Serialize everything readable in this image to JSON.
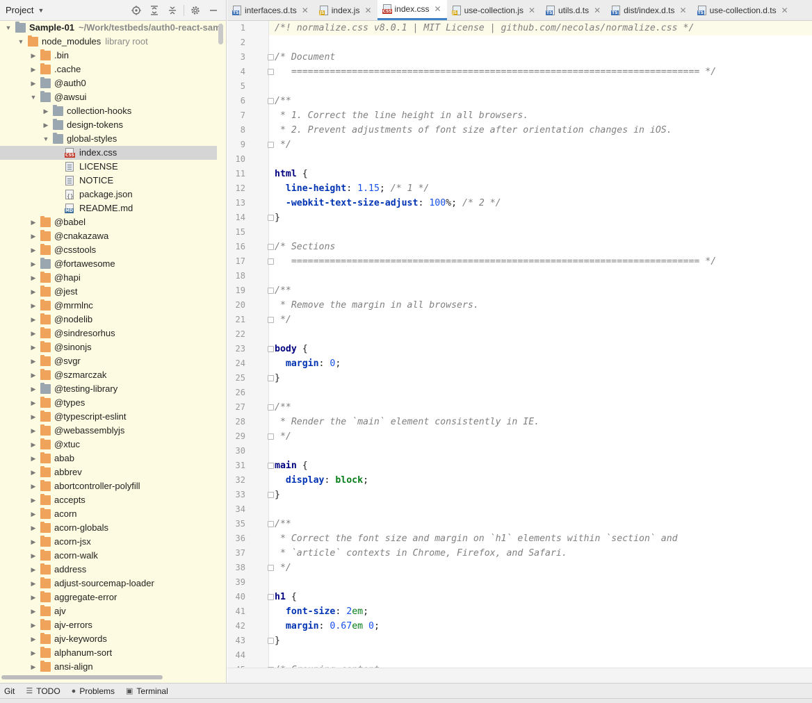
{
  "project_panel": {
    "title": "Project",
    "icons": [
      "locate-icon",
      "expand-all-icon",
      "collapse-all-icon",
      "gear-icon",
      "minimize-icon"
    ]
  },
  "tree": [
    {
      "label": "Sample-01",
      "extra": "~/Work/testbeds/auth0-react-sam",
      "depth": 0,
      "type": "module",
      "expanded": true,
      "bold": true
    },
    {
      "label": "node_modules",
      "extra": "library root",
      "depth": 1,
      "type": "folder-orange",
      "expanded": true
    },
    {
      "label": ".bin",
      "depth": 2,
      "type": "folder-orange",
      "expanded": false
    },
    {
      "label": ".cache",
      "depth": 2,
      "type": "folder-orange",
      "expanded": false
    },
    {
      "label": "@auth0",
      "depth": 2,
      "type": "folder-gray",
      "expanded": false
    },
    {
      "label": "@awsui",
      "depth": 2,
      "type": "folder-gray",
      "expanded": true
    },
    {
      "label": "collection-hooks",
      "depth": 3,
      "type": "folder-gray",
      "expanded": false
    },
    {
      "label": "design-tokens",
      "depth": 3,
      "type": "folder-gray",
      "expanded": false
    },
    {
      "label": "global-styles",
      "depth": 3,
      "type": "folder-gray",
      "expanded": true
    },
    {
      "label": "index.css",
      "depth": 4,
      "type": "file-css",
      "selected": true
    },
    {
      "label": "LICENSE",
      "depth": 4,
      "type": "file-txt"
    },
    {
      "label": "NOTICE",
      "depth": 4,
      "type": "file-txt"
    },
    {
      "label": "package.json",
      "depth": 4,
      "type": "file-json"
    },
    {
      "label": "README.md",
      "depth": 4,
      "type": "file-md"
    },
    {
      "label": "@babel",
      "depth": 2,
      "type": "folder-orange",
      "expanded": false
    },
    {
      "label": "@cnakazawa",
      "depth": 2,
      "type": "folder-orange",
      "expanded": false
    },
    {
      "label": "@csstools",
      "depth": 2,
      "type": "folder-orange",
      "expanded": false
    },
    {
      "label": "@fortawesome",
      "depth": 2,
      "type": "folder-gray",
      "expanded": false
    },
    {
      "label": "@hapi",
      "depth": 2,
      "type": "folder-orange",
      "expanded": false
    },
    {
      "label": "@jest",
      "depth": 2,
      "type": "folder-orange",
      "expanded": false
    },
    {
      "label": "@mrmlnc",
      "depth": 2,
      "type": "folder-orange",
      "expanded": false
    },
    {
      "label": "@nodelib",
      "depth": 2,
      "type": "folder-orange",
      "expanded": false
    },
    {
      "label": "@sindresorhus",
      "depth": 2,
      "type": "folder-orange",
      "expanded": false
    },
    {
      "label": "@sinonjs",
      "depth": 2,
      "type": "folder-orange",
      "expanded": false
    },
    {
      "label": "@svgr",
      "depth": 2,
      "type": "folder-orange",
      "expanded": false
    },
    {
      "label": "@szmarczak",
      "depth": 2,
      "type": "folder-orange",
      "expanded": false
    },
    {
      "label": "@testing-library",
      "depth": 2,
      "type": "folder-gray",
      "expanded": false
    },
    {
      "label": "@types",
      "depth": 2,
      "type": "folder-orange",
      "expanded": false
    },
    {
      "label": "@typescript-eslint",
      "depth": 2,
      "type": "folder-orange",
      "expanded": false
    },
    {
      "label": "@webassemblyjs",
      "depth": 2,
      "type": "folder-orange",
      "expanded": false
    },
    {
      "label": "@xtuc",
      "depth": 2,
      "type": "folder-orange",
      "expanded": false
    },
    {
      "label": "abab",
      "depth": 2,
      "type": "folder-orange",
      "expanded": false
    },
    {
      "label": "abbrev",
      "depth": 2,
      "type": "folder-orange",
      "expanded": false
    },
    {
      "label": "abortcontroller-polyfill",
      "depth": 2,
      "type": "folder-orange",
      "expanded": false
    },
    {
      "label": "accepts",
      "depth": 2,
      "type": "folder-orange",
      "expanded": false
    },
    {
      "label": "acorn",
      "depth": 2,
      "type": "folder-orange",
      "expanded": false
    },
    {
      "label": "acorn-globals",
      "depth": 2,
      "type": "folder-orange",
      "expanded": false
    },
    {
      "label": "acorn-jsx",
      "depth": 2,
      "type": "folder-orange",
      "expanded": false
    },
    {
      "label": "acorn-walk",
      "depth": 2,
      "type": "folder-orange",
      "expanded": false
    },
    {
      "label": "address",
      "depth": 2,
      "type": "folder-orange",
      "expanded": false
    },
    {
      "label": "adjust-sourcemap-loader",
      "depth": 2,
      "type": "folder-orange",
      "expanded": false
    },
    {
      "label": "aggregate-error",
      "depth": 2,
      "type": "folder-orange",
      "expanded": false
    },
    {
      "label": "ajv",
      "depth": 2,
      "type": "folder-orange",
      "expanded": false
    },
    {
      "label": "ajv-errors",
      "depth": 2,
      "type": "folder-orange",
      "expanded": false
    },
    {
      "label": "ajv-keywords",
      "depth": 2,
      "type": "folder-orange",
      "expanded": false
    },
    {
      "label": "alphanum-sort",
      "depth": 2,
      "type": "folder-orange",
      "expanded": false
    },
    {
      "label": "ansi-align",
      "depth": 2,
      "type": "folder-orange",
      "expanded": false
    }
  ],
  "tabs": [
    {
      "label": "interfaces.d.ts",
      "icon": "ts",
      "active": false
    },
    {
      "label": "index.js",
      "icon": "js",
      "active": false
    },
    {
      "label": "index.css",
      "icon": "css",
      "active": true
    },
    {
      "label": "use-collection.js",
      "icon": "js",
      "active": false
    },
    {
      "label": "utils.d.ts",
      "icon": "ts",
      "active": false
    },
    {
      "label": "dist/index.d.ts",
      "icon": "ts",
      "active": false
    },
    {
      "label": "use-collection.d.ts",
      "icon": "ts",
      "active": false
    }
  ],
  "editor": {
    "lines": [
      {
        "n": "1",
        "t": [
          [
            "c",
            "/*! normalize.css v8.0.1 | MIT License | github.com/necolas/normalize.css */"
          ]
        ]
      },
      {
        "n": "2",
        "t": []
      },
      {
        "n": "3",
        "fold": true,
        "t": [
          [
            "c",
            "/* Document"
          ]
        ]
      },
      {
        "n": "4",
        "fold": true,
        "t": [
          [
            "c",
            "   ========================================================================== */"
          ]
        ]
      },
      {
        "n": "5",
        "t": []
      },
      {
        "n": "6",
        "fold": true,
        "t": [
          [
            "c",
            "/**"
          ]
        ]
      },
      {
        "n": "7",
        "t": [
          [
            "c",
            " * 1. Correct the line height in all browsers."
          ]
        ]
      },
      {
        "n": "8",
        "t": [
          [
            "c",
            " * 2. Prevent adjustments of font size after orientation changes in iOS."
          ]
        ]
      },
      {
        "n": "9",
        "fold": true,
        "t": [
          [
            "c",
            " */"
          ]
        ]
      },
      {
        "n": "10",
        "t": []
      },
      {
        "n": "11",
        "t": [
          [
            "s",
            "html"
          ],
          [
            "o",
            " {"
          ]
        ]
      },
      {
        "n": "12",
        "t": [
          [
            "o",
            "  "
          ],
          [
            "p",
            "line-height"
          ],
          [
            "o",
            ": "
          ],
          [
            "n",
            "1.15"
          ],
          [
            "o",
            "; "
          ],
          [
            "c",
            "/* 1 */"
          ]
        ]
      },
      {
        "n": "13",
        "t": [
          [
            "o",
            "  "
          ],
          [
            "p",
            "-webkit-text-size-adjust"
          ],
          [
            "o",
            ": "
          ],
          [
            "n",
            "100"
          ],
          [
            "o",
            "%; "
          ],
          [
            "c",
            "/* 2 */"
          ]
        ]
      },
      {
        "n": "14",
        "fold": true,
        "t": [
          [
            "o",
            "}"
          ]
        ]
      },
      {
        "n": "15",
        "t": []
      },
      {
        "n": "16",
        "fold": true,
        "t": [
          [
            "c",
            "/* Sections"
          ]
        ]
      },
      {
        "n": "17",
        "fold": true,
        "t": [
          [
            "c",
            "   ========================================================================== */"
          ]
        ]
      },
      {
        "n": "18",
        "t": []
      },
      {
        "n": "19",
        "fold": true,
        "t": [
          [
            "c",
            "/**"
          ]
        ]
      },
      {
        "n": "20",
        "t": [
          [
            "c",
            " * Remove the margin in all browsers."
          ]
        ]
      },
      {
        "n": "21",
        "fold": true,
        "t": [
          [
            "c",
            " */"
          ]
        ]
      },
      {
        "n": "22",
        "t": []
      },
      {
        "n": "23",
        "fold": true,
        "t": [
          [
            "s",
            "body"
          ],
          [
            "o",
            " {"
          ]
        ]
      },
      {
        "n": "24",
        "t": [
          [
            "o",
            "  "
          ],
          [
            "p",
            "margin"
          ],
          [
            "o",
            ": "
          ],
          [
            "n",
            "0"
          ],
          [
            "o",
            ";"
          ]
        ]
      },
      {
        "n": "25",
        "fold": true,
        "t": [
          [
            "o",
            "}"
          ]
        ]
      },
      {
        "n": "26",
        "t": []
      },
      {
        "n": "27",
        "fold": true,
        "t": [
          [
            "c",
            "/**"
          ]
        ]
      },
      {
        "n": "28",
        "t": [
          [
            "c",
            " * Render the `main` element consistently in IE."
          ]
        ]
      },
      {
        "n": "29",
        "fold": true,
        "t": [
          [
            "c",
            " */"
          ]
        ]
      },
      {
        "n": "30",
        "t": []
      },
      {
        "n": "31",
        "fold": true,
        "t": [
          [
            "s",
            "main"
          ],
          [
            "o",
            " {"
          ]
        ]
      },
      {
        "n": "32",
        "t": [
          [
            "o",
            "  "
          ],
          [
            "p",
            "display"
          ],
          [
            "o",
            ": "
          ],
          [
            "v",
            "block"
          ],
          [
            "o",
            ";"
          ]
        ]
      },
      {
        "n": "33",
        "fold": true,
        "t": [
          [
            "o",
            "}"
          ]
        ]
      },
      {
        "n": "34",
        "t": []
      },
      {
        "n": "35",
        "fold": true,
        "t": [
          [
            "c",
            "/**"
          ]
        ]
      },
      {
        "n": "36",
        "t": [
          [
            "c",
            " * Correct the font size and margin on `h1` elements within `section` and"
          ]
        ]
      },
      {
        "n": "37",
        "t": [
          [
            "c",
            " * `article` contexts in Chrome, Firefox, and Safari."
          ]
        ]
      },
      {
        "n": "38",
        "fold": true,
        "t": [
          [
            "c",
            " */"
          ]
        ]
      },
      {
        "n": "39",
        "t": []
      },
      {
        "n": "40",
        "fold": true,
        "t": [
          [
            "s",
            "h1"
          ],
          [
            "o",
            " {"
          ]
        ]
      },
      {
        "n": "41",
        "t": [
          [
            "o",
            "  "
          ],
          [
            "p",
            "font-size"
          ],
          [
            "o",
            ": "
          ],
          [
            "n",
            "2"
          ],
          [
            "u",
            "em"
          ],
          [
            "o",
            ";"
          ]
        ]
      },
      {
        "n": "42",
        "t": [
          [
            "o",
            "  "
          ],
          [
            "p",
            "margin"
          ],
          [
            "o",
            ": "
          ],
          [
            "n",
            "0.67"
          ],
          [
            "u",
            "em"
          ],
          [
            "o",
            " "
          ],
          [
            "n",
            "0"
          ],
          [
            "o",
            ";"
          ]
        ]
      },
      {
        "n": "43",
        "fold": true,
        "t": [
          [
            "o",
            "}"
          ]
        ]
      },
      {
        "n": "44",
        "t": []
      },
      {
        "n": "45",
        "fold": true,
        "t": [
          [
            "c",
            "/* Grouping content"
          ]
        ]
      }
    ]
  },
  "bottom_tools": [
    {
      "label": "Git",
      "icon": ""
    },
    {
      "label": "TODO",
      "icon": "list-icon"
    },
    {
      "label": "Problems",
      "icon": "problems-icon"
    },
    {
      "label": "Terminal",
      "icon": "terminal-icon"
    }
  ],
  "colors": {
    "accent": "#4083c9",
    "tree_bg": "#fdfbe1",
    "folder": "#f0a35b"
  }
}
